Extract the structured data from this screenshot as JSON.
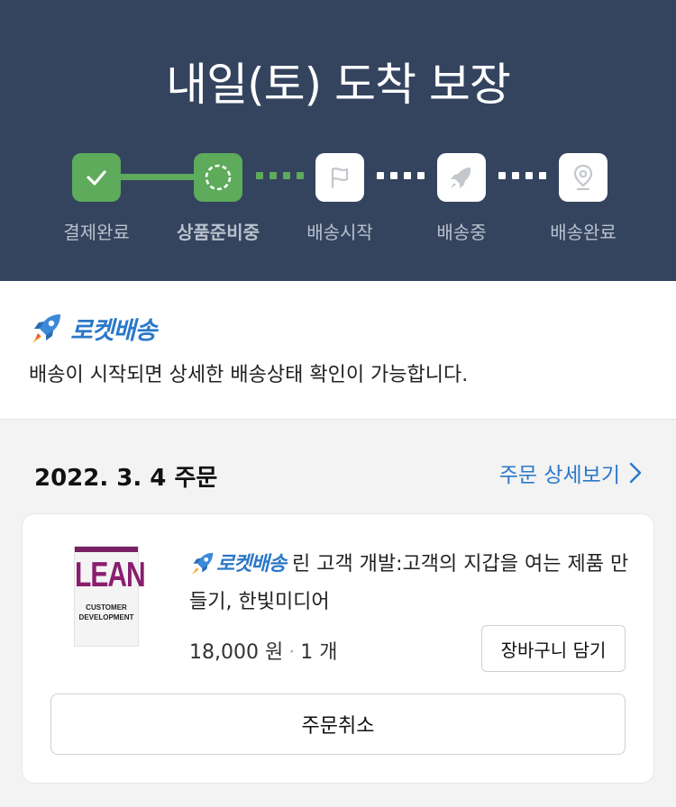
{
  "header": {
    "title": "내일(토) 도착 보장",
    "steps": [
      {
        "label": "결제완료",
        "icon": "check-icon",
        "status": "done"
      },
      {
        "label": "상품준비중",
        "icon": "spinner-icon",
        "status": "current"
      },
      {
        "label": "배송시작",
        "icon": "flag-icon",
        "status": "pending"
      },
      {
        "label": "배송중",
        "icon": "rocket-icon",
        "status": "pending"
      },
      {
        "label": "배송완료",
        "icon": "location-pin-icon",
        "status": "pending"
      }
    ],
    "colors": {
      "background": "#34445f",
      "done": "#5dab5b",
      "label": "#b9c1cd"
    }
  },
  "rocket_info": {
    "brand": "로켓배송",
    "description": "배송이 시작되면 상세한 배송상태 확인이 가능합니다."
  },
  "order": {
    "date_label": "2022. 3. 4 주문",
    "detail_link": "주문 상세보기",
    "item": {
      "brand": "로켓배송",
      "title": "린 고객 개발:고객의 지갑을 여는 제품 만들기, 한빛미디어",
      "price": "18,000 원",
      "quantity": "1 개",
      "cover": {
        "title": "LEAN",
        "subtitle": "CUSTOMER DEVELOPMENT"
      }
    },
    "cart_button": "장바구니 담기",
    "cancel_button": "주문취소"
  },
  "accent_color": "#2b78c9"
}
